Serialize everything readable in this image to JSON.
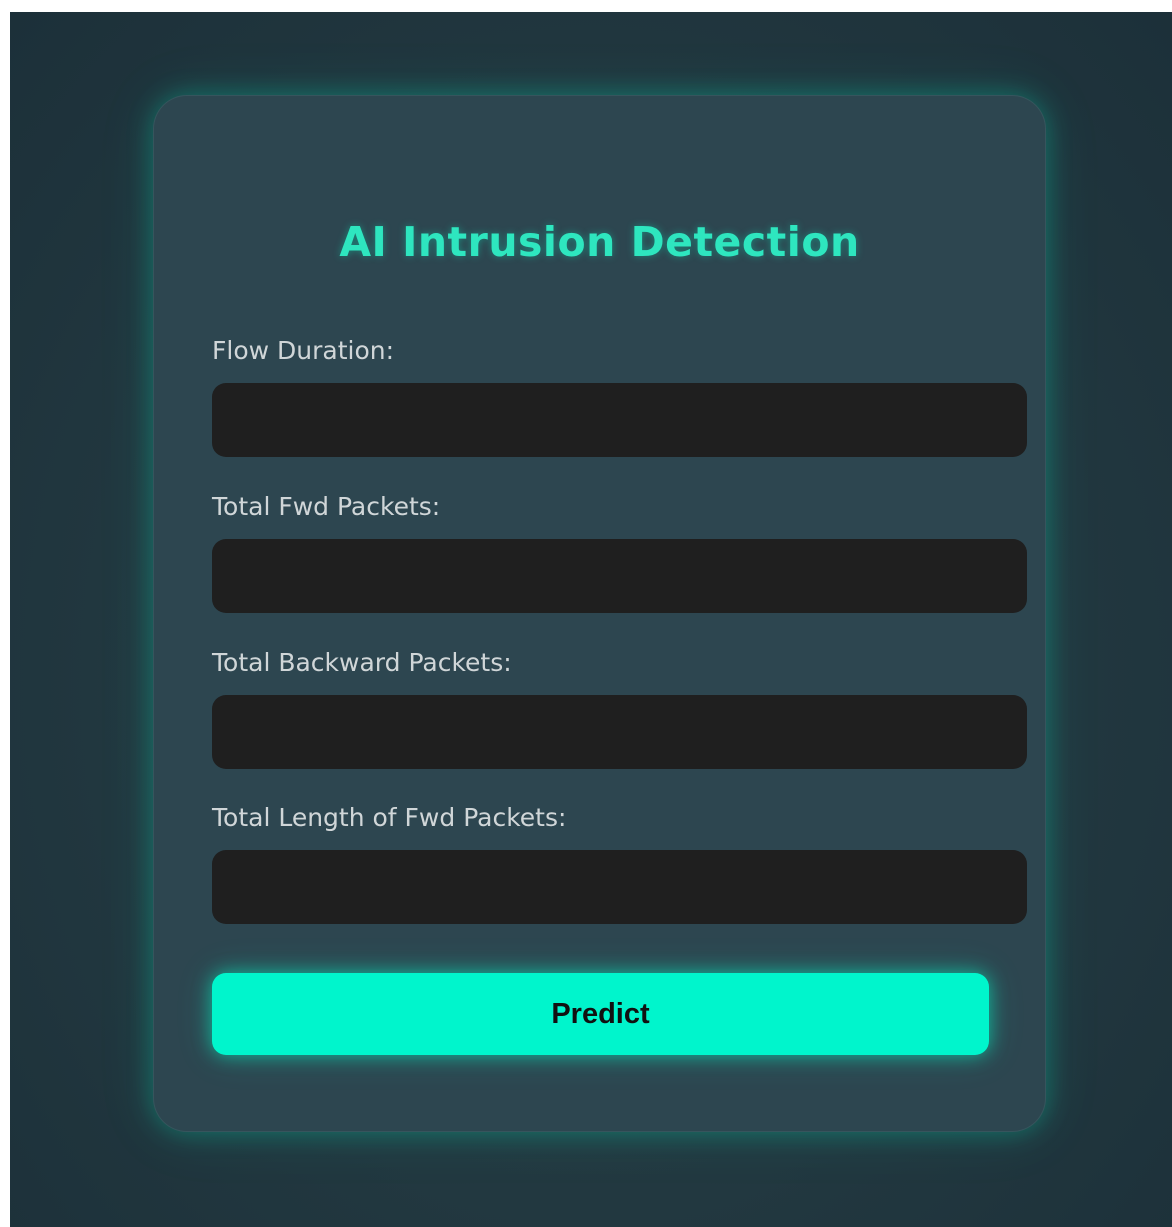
{
  "form": {
    "title": "AI Intrusion Detection",
    "fields": [
      {
        "label": "Flow Duration:",
        "value": "",
        "placeholder": ""
      },
      {
        "label": "Total Fwd Packets:",
        "value": "",
        "placeholder": ""
      },
      {
        "label": "Total Backward Packets:",
        "value": "",
        "placeholder": ""
      },
      {
        "label": "Total Length of Fwd Packets:",
        "value": "",
        "placeholder": ""
      }
    ],
    "submit_label": "Predict"
  },
  "colors": {
    "accent": "#00f5cc",
    "title": "#2ee6bf",
    "card_background": "#2d4650",
    "input_background": "#1f1f1f",
    "page_background": "#223840"
  }
}
